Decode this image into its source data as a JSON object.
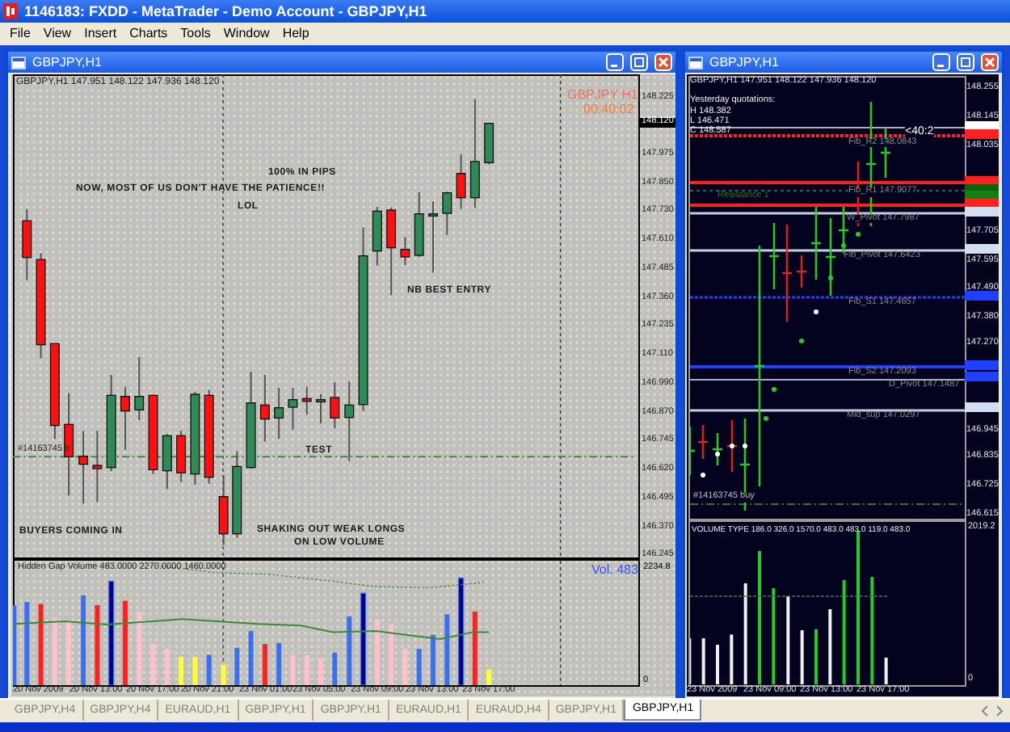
{
  "window": {
    "title": "1146183: FXDD - MetaTrader - Demo Account - GBPJPY,H1"
  },
  "menu": [
    "File",
    "View",
    "Insert",
    "Charts",
    "Tools",
    "Window",
    "Help"
  ],
  "charts": [
    {
      "title": "GBPJPY,H1",
      "info": "GBPJPY,H1  147.951 148.122 147.936 148.120",
      "symbol": "GBPJPY  H1",
      "timer": "00:40:02",
      "current_price": "148.120",
      "price_ticks": [
        "148.225",
        "147.975",
        "147.850",
        "147.730",
        "147.610",
        "147.485",
        "147.360",
        "147.235",
        "147.110",
        "146.990",
        "146.870",
        "146.745",
        "146.620",
        "146.495",
        "146.370",
        "146.245"
      ],
      "annotations": [
        "100% IN PIPS",
        "NOW, MOST OF US DON'T HAVE THE PATIENCE!!",
        "LOL",
        "NB BEST ENTRY",
        "TEST",
        "BUYERS COMING IN",
        "SHAKING OUT WEAK LONGS",
        "ON LOW VOLUME"
      ],
      "order_label": "#14163745 b",
      "indicator": {
        "label": "Hidden Gap Volume 483.0000 2270.0000 1460.0000",
        "reading": "Vol. 483",
        "ticks": [
          "2234.8",
          "0"
        ]
      },
      "time_labels": [
        "20 Nov 2009",
        "20 Nov 13:00",
        "20 Nov 17:00",
        "20 Nov 21:00",
        "23 Nov 01:00",
        "23 Nov 05:00",
        "23 Nov 09:00",
        "23 Nov 13:00",
        "23 Nov 17:00"
      ]
    },
    {
      "title": "GBPJPY,H1",
      "info": "GBPJPY,H1  147.951 148.122 147.936 148.120",
      "quotations": [
        "Yesterday quotations:",
        "H 148.382",
        "L 146.471",
        "C 148.587"
      ],
      "timer": "<40:2",
      "levels": [
        {
          "label": "Fib_R2 148.0843",
          "color": "#8a8a8a"
        },
        {
          "label": "Resistance 1",
          "color": "#1f7a1f"
        },
        {
          "label": "Fib_R1 147.9077",
          "color": "#8a8a8a"
        },
        {
          "label": "W_Pivot 147.7987",
          "color": "#8a8a8a"
        },
        {
          "label": "Fib_Pivot 147.6423",
          "color": "#8a8a8a"
        },
        {
          "label": "Fib_S1 147.4657",
          "color": "#8a8a8a"
        },
        {
          "label": "Fib_S2 147.2093",
          "color": "#8a8a8a"
        },
        {
          "label": "D_Pivot 147.1487",
          "color": "#8a8a8a"
        },
        {
          "label": "Mid_sup 147.0297",
          "color": "#8a8a8a"
        }
      ],
      "price_ticks": [
        "148.255",
        "148.145",
        "148.035",
        "147.705",
        "147.595",
        "147.490",
        "147.380",
        "147.270",
        "146.945",
        "146.835",
        "146.725",
        "146.615"
      ],
      "order_label": "#14163745 buy",
      "indicator": {
        "label": "VOLUME TYPE 186.0 326.0 1570.0 483.0 483.0 119.0 483.0",
        "ticks": [
          "2019.2",
          "0"
        ]
      },
      "time_labels": [
        "23 Nov 2009",
        "23 Nov 09:00",
        "23 Nov 13:00",
        "23 Nov 17:00"
      ]
    }
  ],
  "tabs": [
    {
      "label": "GBPJPY,H4",
      "selected": false
    },
    {
      "label": "GBPJPY,H4",
      "selected": false
    },
    {
      "label": "EURAUD,H1",
      "selected": false
    },
    {
      "label": "GBPJPY,H1",
      "selected": false
    },
    {
      "label": "GBPJPY,H1",
      "selected": false
    },
    {
      "label": "EURAUD,H1",
      "selected": false
    },
    {
      "label": "EURAUD,H4",
      "selected": false
    },
    {
      "label": "GBPJPY,H1",
      "selected": false
    },
    {
      "label": "GBPJPY,H1",
      "selected": true
    }
  ]
}
